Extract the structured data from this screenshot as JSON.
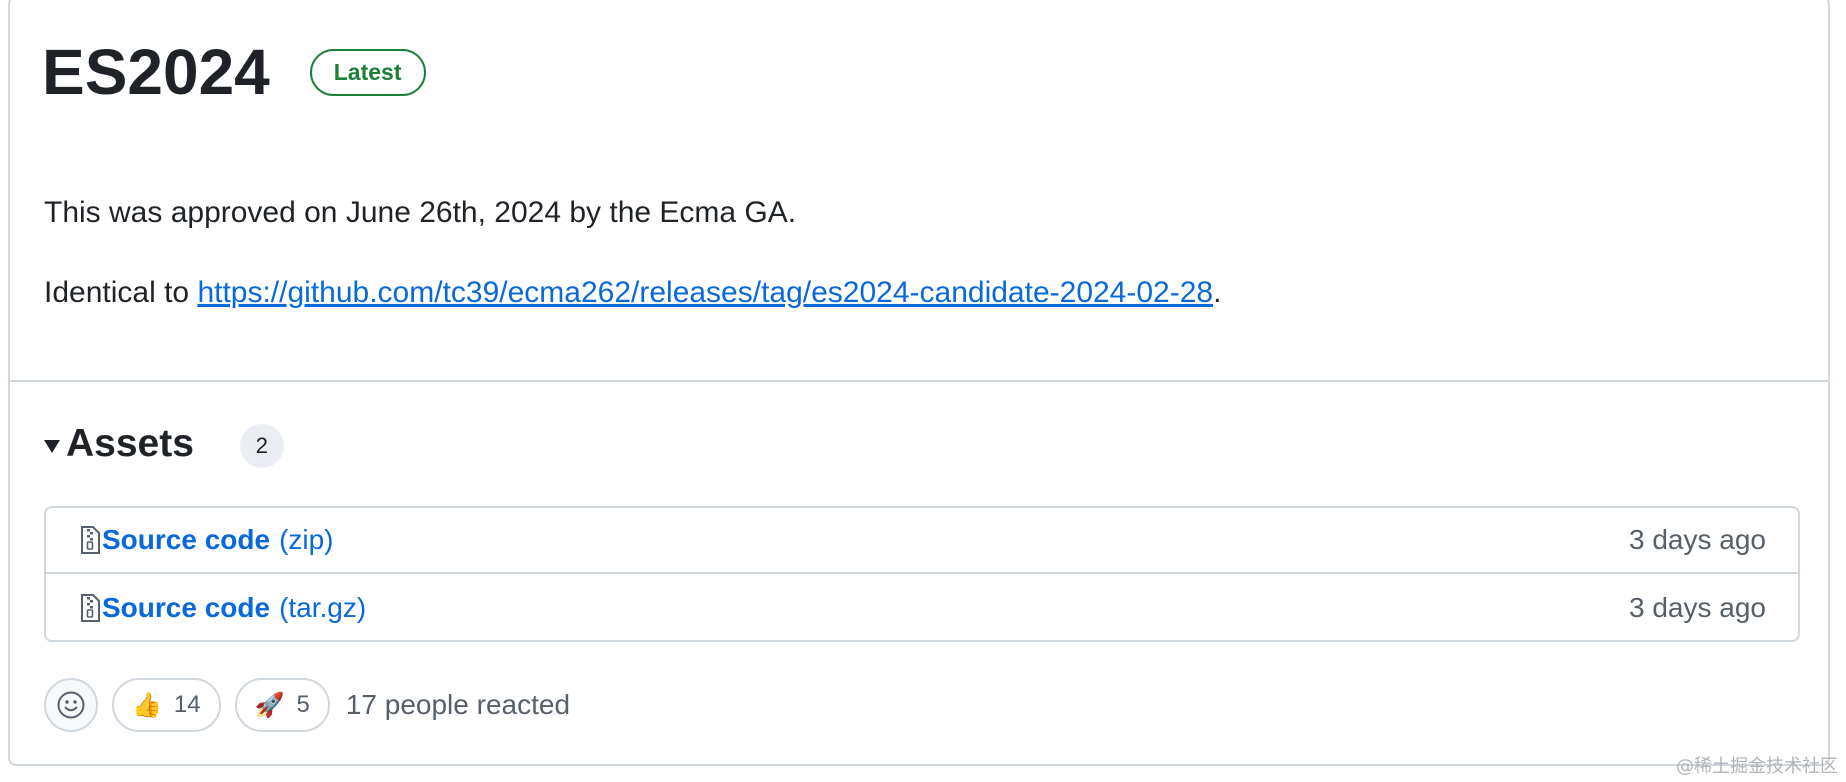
{
  "release": {
    "title": "ES2024",
    "badge": "Latest",
    "description_line1": "This was approved on June 26th, 2024 by the Ecma GA.",
    "identical_prefix": "Identical to ",
    "identical_link": "https://github.com/tc39/ecma262/releases/tag/es2024-candidate-2024-02-28",
    "identical_suffix": "."
  },
  "assets": {
    "title": "Assets",
    "count": "2",
    "items": [
      {
        "name": "Source code",
        "ext": "(zip)",
        "time": "3 days ago",
        "icon": "file-zip-icon"
      },
      {
        "name": "Source code",
        "ext": "(tar.gz)",
        "time": "3 days ago",
        "icon": "file-zip-icon"
      }
    ]
  },
  "reactions": {
    "items": [
      {
        "emoji": "👍",
        "count": "14"
      },
      {
        "emoji": "🚀",
        "count": "5"
      }
    ],
    "summary": "17 people reacted"
  },
  "watermark": "@稀土掘金技术社区",
  "colors": {
    "accent_link": "#0969da",
    "latest_green": "#1a7f37",
    "border": "#d0d7de",
    "muted_text": "#57606a"
  }
}
